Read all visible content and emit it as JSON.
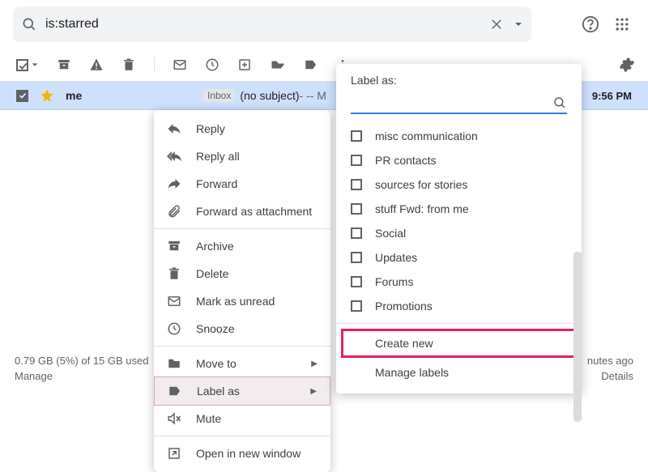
{
  "search": {
    "query": "is:starred"
  },
  "mail": {
    "sender": "me",
    "inbox_chip": "Inbox",
    "subject": "(no subject)",
    "snippet": " - -- M",
    "time": "9:56 PM"
  },
  "context_menu": {
    "reply": "Reply",
    "reply_all": "Reply all",
    "forward": "Forward",
    "forward_attachment": "Forward as attachment",
    "archive": "Archive",
    "delete": "Delete",
    "mark_unread": "Mark as unread",
    "snooze": "Snooze",
    "move_to": "Move to",
    "label_as": "Label as",
    "mute": "Mute",
    "open_new_window": "Open in new window"
  },
  "label_panel": {
    "title": "Label as:",
    "items": [
      "misc communication",
      "PR contacts",
      "sources for stories",
      "stuff Fwd: from me",
      "Social",
      "Updates",
      "Forums",
      "Promotions"
    ],
    "create_new": "Create new",
    "manage": "Manage labels"
  },
  "footer": {
    "storage": "0.79 GB (5%) of 15 GB used",
    "manage": "Manage",
    "activity": "nutes ago",
    "details": "Details"
  }
}
